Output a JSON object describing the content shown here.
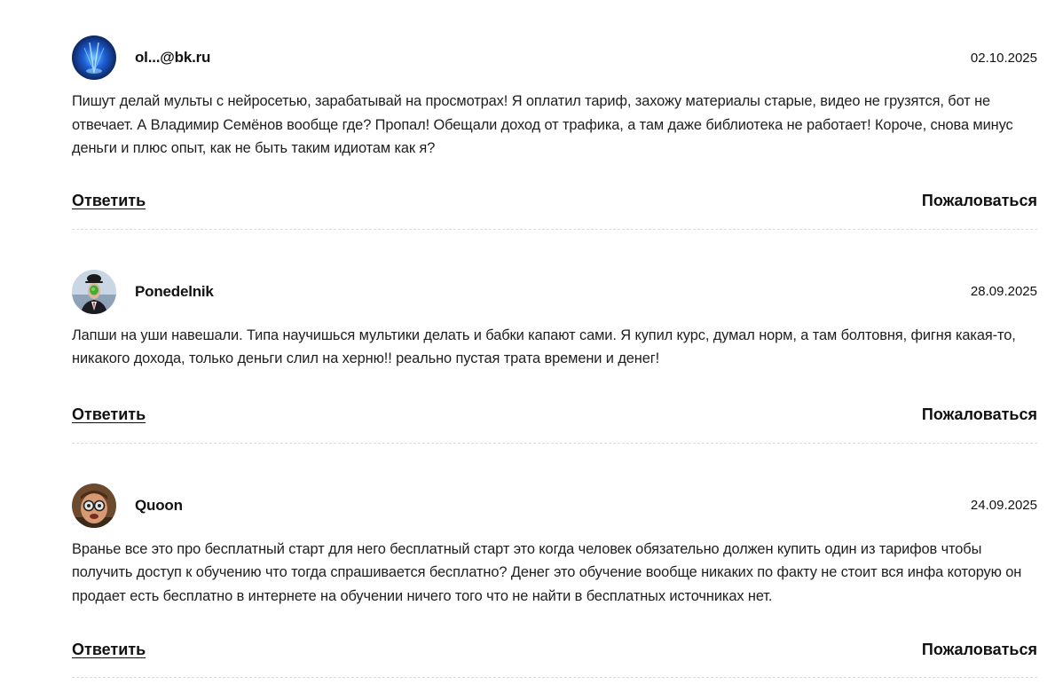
{
  "comments": [
    {
      "author": "ol...@bk.ru",
      "date": "02.10.2025",
      "avatar_icon": "blue-abstract-avatar",
      "text": "Пишут делай мульты с нейросетью, зарабатывай на просмотрах! Я оплатил тариф, захожу материалы старые, видео не грузятся, бот не отвечает. А Владимир Семёнов вообще где? Пропал! Обещали доход от трафика, а там даже библиотека не работает! Короче, снова минус деньги и плюс опыт, как не быть таким идиотам как я?",
      "reply_label": "Ответить",
      "report_label": "Пожаловаться"
    },
    {
      "author": "Ponedelnik",
      "date": "28.09.2025",
      "avatar_icon": "man-in-bowler-hat-avatar",
      "text": "Лапши на уши навешали. Типа научишься мультики делать и бабки капают сами. Я купил курс, думал норм, а там болтовня, фигня какая-то, никакого дохода, только деньги слил на херню!! реально пустая трата времени и денег!",
      "reply_label": "Ответить",
      "report_label": "Пожаловаться"
    },
    {
      "author": "Quoon",
      "date": "24.09.2025",
      "avatar_icon": "man-with-glasses-avatar",
      "text": "Вранье все это про бесплатный старт для него бесплатный старт это когда человек обязательно должен купить один из тарифов чтобы получить доступ к обучению что тогда спрашивается бесплатно? Денег это обучение вообще никаких по факту не стоит вся инфа которую он продает есть бесплатно в интернете на обучении ничего того что не найти в бесплатных источниках нет.",
      "reply_label": "Ответить",
      "report_label": "Пожаловаться"
    }
  ]
}
